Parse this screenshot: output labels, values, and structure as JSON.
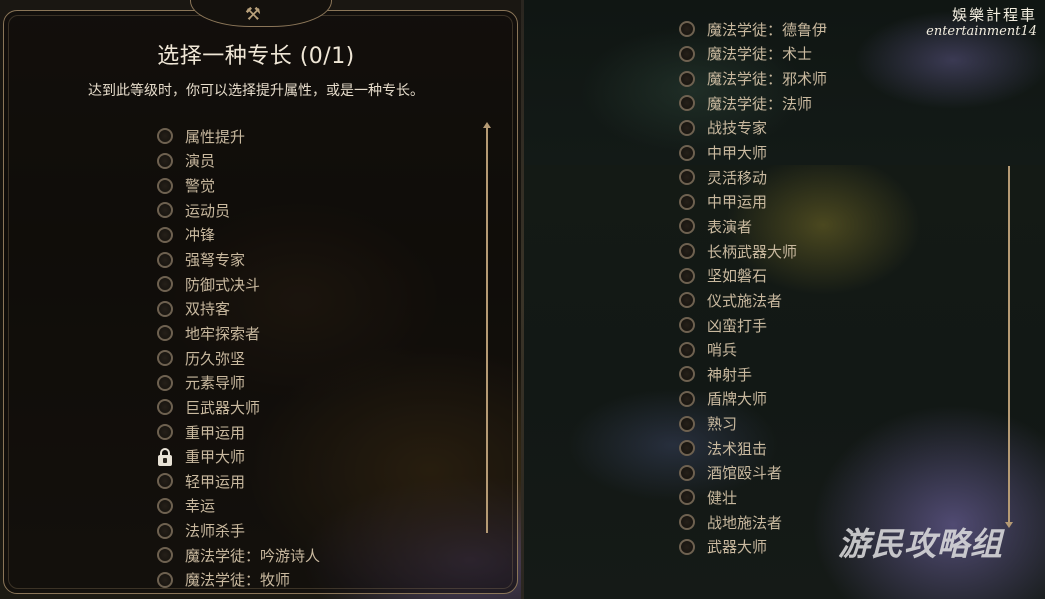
{
  "dialog": {
    "title": "选择一种专长 (0/1)",
    "subtitle": "达到此等级时，你可以选择提升属性，或是一种专长。"
  },
  "feats_left": [
    {
      "label": "属性提升",
      "locked": false
    },
    {
      "label": "演员",
      "locked": false
    },
    {
      "label": "警觉",
      "locked": false
    },
    {
      "label": "运动员",
      "locked": false
    },
    {
      "label": "冲锋",
      "locked": false
    },
    {
      "label": "强弩专家",
      "locked": false
    },
    {
      "label": "防御式决斗",
      "locked": false
    },
    {
      "label": "双持客",
      "locked": false
    },
    {
      "label": "地牢探索者",
      "locked": false
    },
    {
      "label": "历久弥坚",
      "locked": false
    },
    {
      "label": "元素导师",
      "locked": false
    },
    {
      "label": "巨武器大师",
      "locked": false
    },
    {
      "label": "重甲运用",
      "locked": false
    },
    {
      "label": "重甲大师",
      "locked": true
    },
    {
      "label": "轻甲运用",
      "locked": false
    },
    {
      "label": "幸运",
      "locked": false
    },
    {
      "label": "法师杀手",
      "locked": false
    },
    {
      "label": "魔法学徒：吟游诗人",
      "locked": false
    },
    {
      "label": "魔法学徒：牧师",
      "locked": false
    }
  ],
  "feats_right": [
    {
      "label": "魔法学徒：德鲁伊"
    },
    {
      "label": "魔法学徒：术士"
    },
    {
      "label": "魔法学徒：邪术师"
    },
    {
      "label": "魔法学徒：法师"
    },
    {
      "label": "战技专家"
    },
    {
      "label": "中甲大师"
    },
    {
      "label": "灵活移动"
    },
    {
      "label": "中甲运用"
    },
    {
      "label": "表演者"
    },
    {
      "label": "长柄武器大师"
    },
    {
      "label": "坚如磐石"
    },
    {
      "label": "仪式施法者"
    },
    {
      "label": "凶蛮打手"
    },
    {
      "label": "哨兵"
    },
    {
      "label": "神射手"
    },
    {
      "label": "盾牌大师"
    },
    {
      "label": "熟习"
    },
    {
      "label": "法术狙击"
    },
    {
      "label": "酒馆殴斗者"
    },
    {
      "label": "健壮"
    },
    {
      "label": "战地施法者"
    },
    {
      "label": "武器大师"
    }
  ],
  "watermark": {
    "top_line1": "娛樂計程車",
    "top_line2": "entertainment14",
    "bottom": "游民攻略组"
  },
  "icons": {
    "dialog_top": "crossed-tools-icon",
    "unselected": "radio-circle-icon",
    "locked": "padlock-icon"
  },
  "colors": {
    "frame": "#8a7558",
    "text": "#c9b99f",
    "title": "#efe6d6"
  }
}
